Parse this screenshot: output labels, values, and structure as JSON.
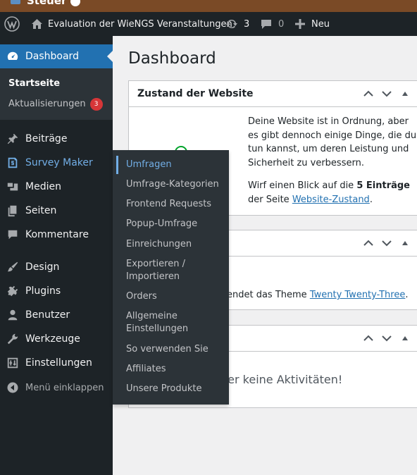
{
  "toolbar_top": {
    "site_label": "Steuer"
  },
  "adminbar": {
    "site_name": "Evaluation der WieNGS Veranstaltungen",
    "updates_count": "3",
    "comments_count": "0",
    "new_label": "Neu"
  },
  "sidebar": {
    "dashboard": "Dashboard",
    "home": "Startseite",
    "updates": "Aktualisierungen",
    "updates_badge": "3",
    "posts": "Beiträge",
    "survey_maker": "Survey Maker",
    "media": "Medien",
    "pages": "Seiten",
    "comments": "Kommentare",
    "design": "Design",
    "plugins": "Plugins",
    "users": "Benutzer",
    "tools": "Werkzeuge",
    "settings": "Einstellungen",
    "collapse": "Menü einklappen"
  },
  "flyout": {
    "items": [
      "Umfragen",
      "Umfrage-Kategorien",
      "Frontend Requests",
      "Popup-Umfrage",
      "Einreichungen",
      "Exportieren / Importieren",
      "Orders",
      "Allgemeine Einstellungen",
      "So verwenden Sie",
      "Affiliates",
      "Unsere Produkte"
    ]
  },
  "main": {
    "title": "Dashboard",
    "site_health": {
      "title": "Zustand der Website",
      "text1": "Deine Website ist in Ordnung, aber es gibt dennoch einige Dinge, die du tun kannst, um deren Leistung und Sicherheit zu verbessern.",
      "text2_a": "Wirf einen Blick auf die ",
      "text2_bold": "5 Einträge",
      "text2_b": " der Seite ",
      "text2_link": "Website-Zustand",
      "text2_end": "."
    },
    "glance": {
      "text_partial": "endet das Theme ",
      "theme_link": "Twenty Twenty-Three",
      "text_end": "."
    },
    "activity": {
      "text_partial": "her keine Aktivitäten!"
    }
  }
}
